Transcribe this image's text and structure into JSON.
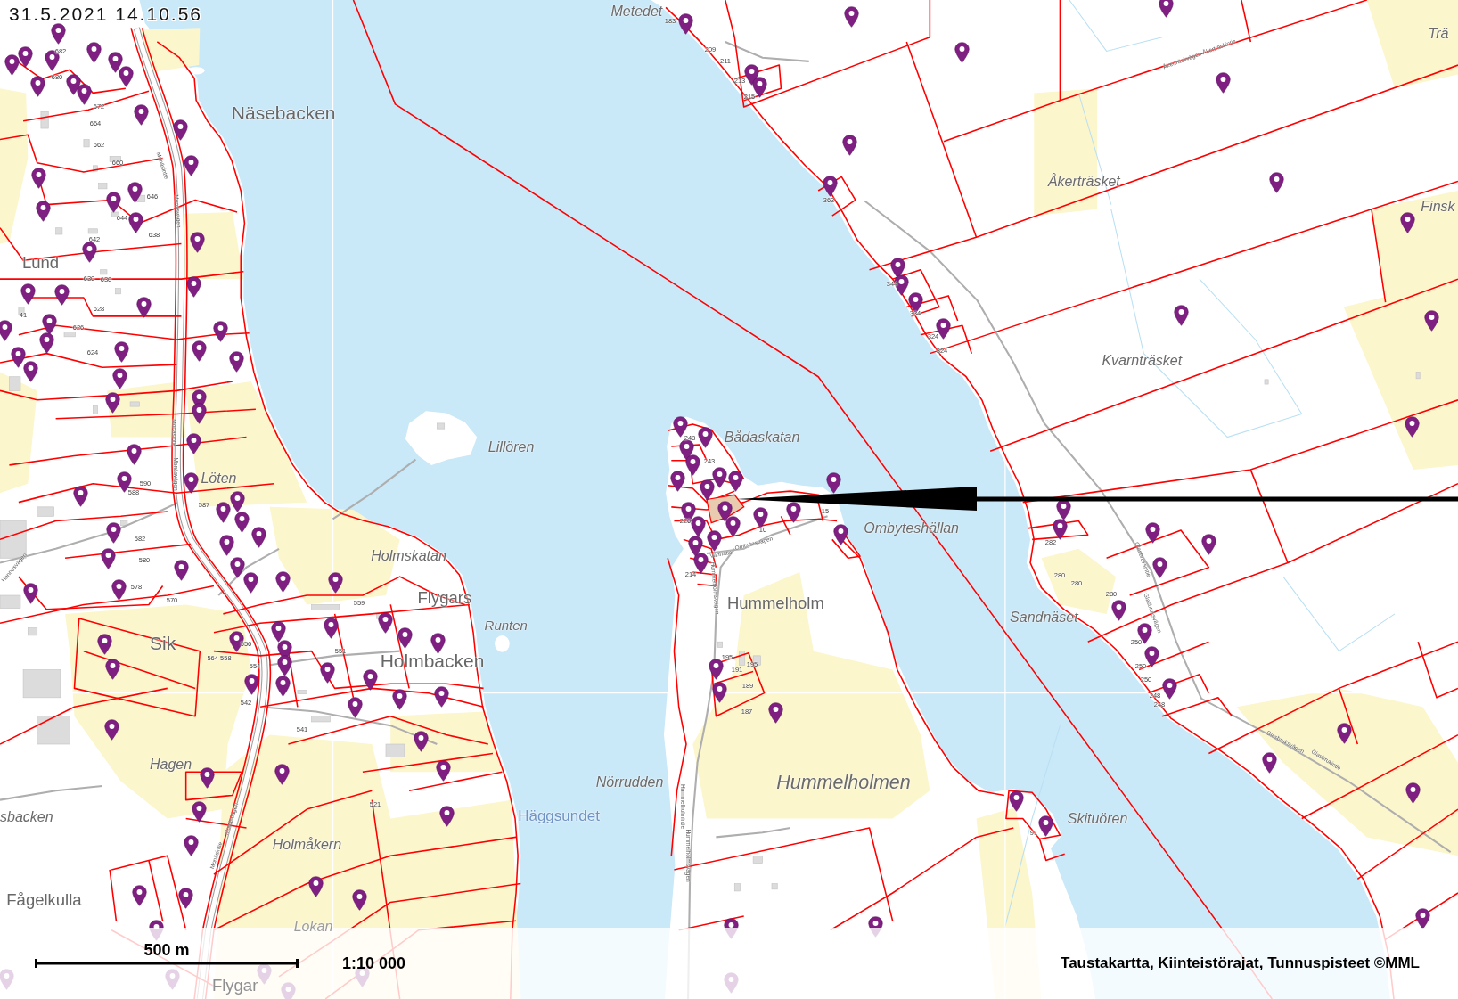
{
  "timestamp": "31.5.2021 14.10.56",
  "map": {
    "place_names": [
      {
        "text": "Näsebacken",
        "kind": "settlement"
      },
      {
        "text": "Lund",
        "kind": "settlement"
      },
      {
        "text": "Lillören",
        "kind": "nature"
      },
      {
        "text": "Löten",
        "kind": "nature"
      },
      {
        "text": "Holmskatan",
        "kind": "nature"
      },
      {
        "text": "Flygars",
        "kind": "settlement"
      },
      {
        "text": "Runten",
        "kind": "nature"
      },
      {
        "text": "Sik",
        "kind": "settlement"
      },
      {
        "text": "Holmbacken",
        "kind": "settlement"
      },
      {
        "text": "Hagen",
        "kind": "nature"
      },
      {
        "text": "sbacken",
        "kind": "nature"
      },
      {
        "text": "Fågelkulla",
        "kind": "settlement"
      },
      {
        "text": "Holmåkern",
        "kind": "nature"
      },
      {
        "text": "Lokan",
        "kind": "nature"
      },
      {
        "text": "Flygar",
        "kind": "settlement"
      },
      {
        "text": "Metedet",
        "kind": "nature"
      },
      {
        "text": "Trä",
        "kind": "nature"
      },
      {
        "text": "Åkerträsket",
        "kind": "nature"
      },
      {
        "text": "Finsk",
        "kind": "nature"
      },
      {
        "text": "Kvarnträsket",
        "kind": "nature"
      },
      {
        "text": "Bådaskatan",
        "kind": "nature"
      },
      {
        "text": "Ombyteshällan",
        "kind": "nature"
      },
      {
        "text": "Hummelholm",
        "kind": "settlement"
      },
      {
        "text": "Sandnäset",
        "kind": "nature"
      },
      {
        "text": "Nörrudden",
        "kind": "nature"
      },
      {
        "text": "Häggsundet",
        "kind": "water"
      },
      {
        "text": "Hummelholmen",
        "kind": "nature"
      },
      {
        "text": "Skituören",
        "kind": "nature"
      }
    ],
    "parcel_numbers": [
      "682",
      "680",
      "672",
      "664",
      "662",
      "660",
      "646",
      "644",
      "642",
      "638",
      "630",
      "630",
      "628",
      "626",
      "624",
      "41",
      "590",
      "588",
      "587",
      "582",
      "580",
      "578",
      "570",
      "559",
      "556",
      "564 558",
      "554",
      "551",
      "542",
      "541",
      "521",
      "248",
      "243",
      "226",
      "10",
      "15",
      "214",
      "282",
      "280",
      "280",
      "280",
      "195",
      "195",
      "191",
      "189",
      "187",
      "183",
      "209",
      "211",
      "213",
      "215",
      "363",
      "344",
      "334",
      "324",
      "324",
      "250",
      "250",
      "250",
      "248",
      "248",
      "91"
    ],
    "road_names": [
      "Monäsintie",
      "Monäsvägen",
      "Monäsintie",
      "Monäsvägen",
      "Hannesvägen",
      "Monäsvägen",
      "Monäsintie",
      "Åkerträskvägen Åkerträskintie",
      "Vanhatie",
      "Ombytesvägen",
      "Hummelholmsvägen",
      "Hummelholmintie",
      "Hummelholmsvägen",
      "Glasbruksintie",
      "Glasbruksvägen",
      "Glasbruksvägen",
      "Glasbrukintie"
    ]
  },
  "scale_bar": {
    "distance": "500 m",
    "scale": "1:10 000"
  },
  "attribution": "Taustakartta, Kiinteistörajat, Tunnuspisteet ©MML"
}
